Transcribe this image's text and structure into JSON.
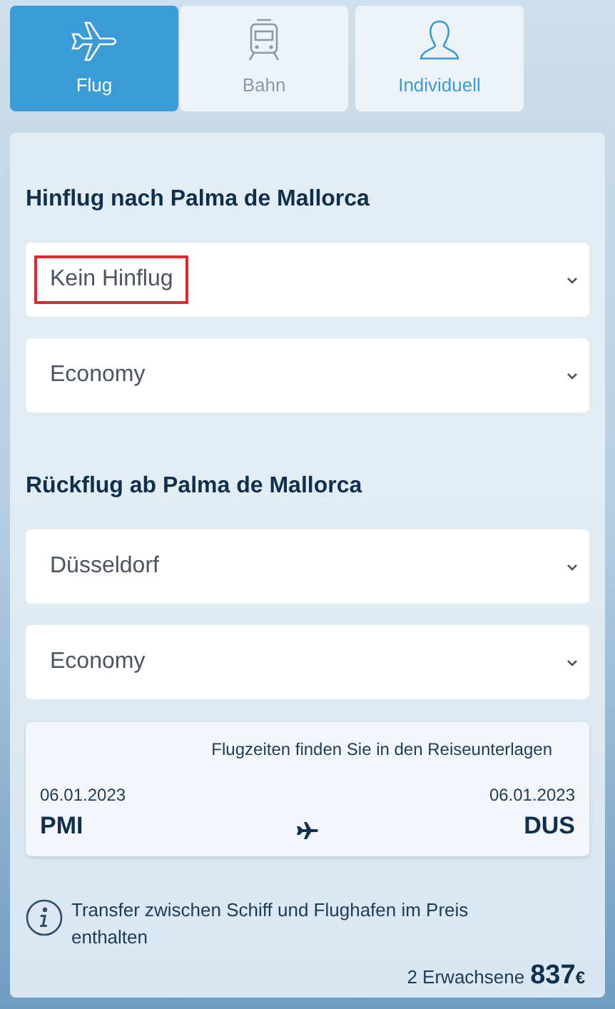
{
  "tabs": [
    {
      "label": "Flug",
      "kind": "plane",
      "selected": true,
      "disabled": false
    },
    {
      "label": "Bahn",
      "kind": "train",
      "selected": false,
      "disabled": true
    },
    {
      "label": "Individuell",
      "kind": "person",
      "selected": false,
      "disabled": false
    }
  ],
  "outbound": {
    "heading": "Hinflug nach Palma de Mallorca",
    "selects": [
      {
        "value": "Kein Hinflug",
        "highlighted": true
      },
      {
        "value": "Economy",
        "highlighted": false
      }
    ]
  },
  "return": {
    "heading": "Rückflug ab Palma de Mallorca",
    "selects": [
      {
        "value": "Düsseldorf",
        "highlighted": false
      },
      {
        "value": "Economy",
        "highlighted": false
      }
    ]
  },
  "flight_info": {
    "note": "Flugzeiten finden Sie in den Reiseunterlagen",
    "departure": {
      "date": "06.01.2023",
      "code": "PMI"
    },
    "arrival": {
      "date": "06.01.2023",
      "code": "DUS"
    }
  },
  "transfer_note": "Transfer zwischen Schiff und Flughafen im Preis enthalten",
  "price": {
    "travelers": "2 Erwachsene",
    "amount": "837",
    "currency": "€"
  }
}
